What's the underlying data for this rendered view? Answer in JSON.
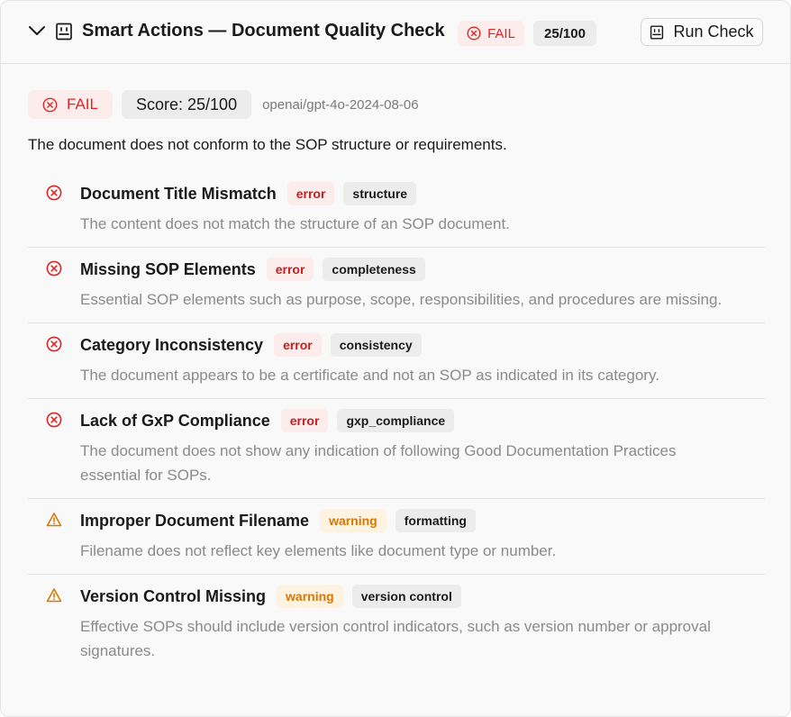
{
  "header": {
    "title": "Smart Actions — Document Quality Check",
    "status": "FAIL",
    "score": "25/100",
    "run_button": "Run Check"
  },
  "summary": {
    "status": "FAIL",
    "score": "Score: 25/100",
    "model": "openai/gpt-4o-2024-08-06",
    "description": "The document does not conform to the SOP structure or requirements."
  },
  "issues": [
    {
      "icon": "error-circle-x-icon",
      "title": "Document Title Mismatch",
      "severity": "error",
      "category": "structure",
      "description": "The content does not match the structure of an SOP document."
    },
    {
      "icon": "error-circle-x-icon",
      "title": "Missing SOP Elements",
      "severity": "error",
      "category": "completeness",
      "description": "Essential SOP elements such as purpose, scope, responsibilities, and procedures are missing."
    },
    {
      "icon": "error-circle-x-icon",
      "title": "Category Inconsistency",
      "severity": "error",
      "category": "consistency",
      "description": "The document appears to be a certificate and not an SOP as indicated in its category."
    },
    {
      "icon": "error-circle-x-icon",
      "title": "Lack of GxP Compliance",
      "severity": "error",
      "category": "gxp_compliance",
      "description": "The document does not show any indication of following Good Documentation Practices essential for SOPs."
    },
    {
      "icon": "warning-triangle-icon",
      "title": "Improper Document Filename",
      "severity": "warning",
      "category": "formatting",
      "description": "Filename does not reflect key elements like document type or number."
    },
    {
      "icon": "warning-triangle-icon",
      "title": "Version Control Missing",
      "severity": "warning",
      "category": "version control",
      "description": "Effective SOPs should include version control indicators, such as version number or approval signatures."
    }
  ],
  "colors": {
    "error": "#dc2626",
    "warning": "#d97706",
    "badge_error_bg": "#fcecec",
    "badge_warning_bg": "#fdf3e0",
    "neutral_badge_bg": "#ececec"
  }
}
